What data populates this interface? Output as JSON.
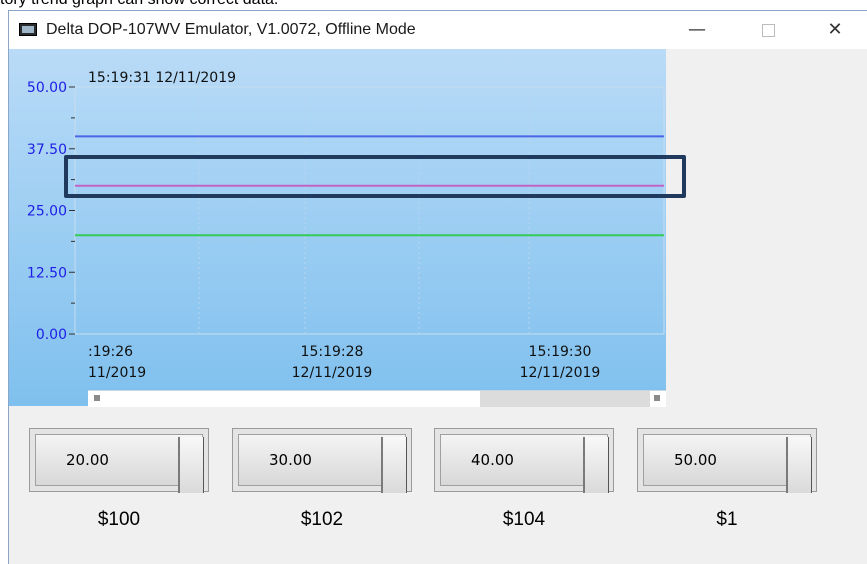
{
  "caption": "tory trend graph can show correct data.",
  "window": {
    "title": "Delta DOP-107WV Emulator, V1.0072, Offline Mode",
    "controls": {
      "minimize": "—",
      "close": "✕"
    }
  },
  "trend": {
    "header": "15:19:31 12/11/2019",
    "y_ticks": [
      "50.00",
      "37.50",
      "25.00",
      "12.50",
      "0.00"
    ],
    "x_ticks": [
      {
        "time": ":19:26",
        "date": "11/2019"
      },
      {
        "time": "15:19:28",
        "date": "12/11/2019"
      },
      {
        "time": "15:19:30",
        "date": "12/11/2019"
      }
    ]
  },
  "chart_data": {
    "type": "line",
    "title": "",
    "xlabel": "",
    "ylabel": "",
    "ylim": [
      0,
      50
    ],
    "grid": true,
    "series": [
      {
        "values": [
          40,
          40
        ],
        "color": "#4a68e6"
      },
      {
        "values": [
          30,
          30
        ],
        "color": "#c263c8"
      },
      {
        "values": [
          20,
          20
        ],
        "color": "#33cc55"
      }
    ]
  },
  "sliders": [
    {
      "value": "20.00",
      "label": "$100"
    },
    {
      "value": "30.00",
      "label": "$102"
    },
    {
      "value": "40.00",
      "label": "$104"
    },
    {
      "value": "50.00",
      "label": "$1"
    }
  ],
  "colors": {
    "tick_text": "#1e1ee6",
    "highlight": "#1f3a5c"
  }
}
